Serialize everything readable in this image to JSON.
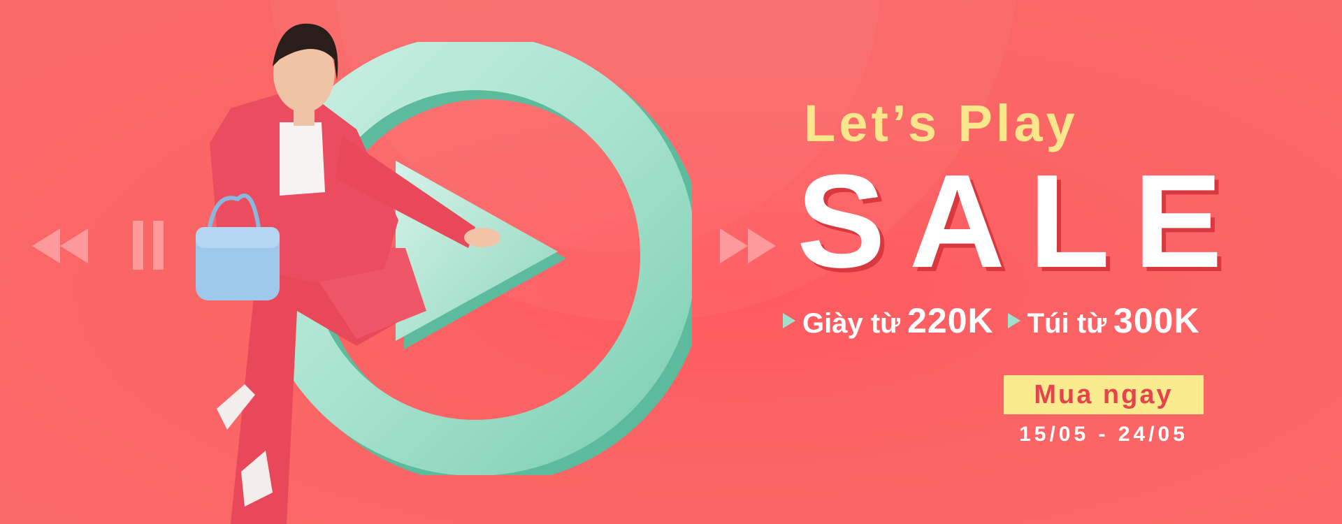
{
  "banner": {
    "headline": "Let’s Play",
    "title": "SALE",
    "offers": [
      {
        "label": "Giày từ",
        "price": "220K"
      },
      {
        "label": "Túi từ",
        "price": "300K"
      }
    ],
    "cta_label": "Mua ngay",
    "date_range": "15/05 - 24/05"
  },
  "icons": {
    "rewind": "rewind-icon",
    "pause": "pause-icon",
    "play": "play-icon",
    "fast_forward": "fast-forward-icon"
  },
  "colors": {
    "background": "#fa6262",
    "headline": "#fbe78b",
    "title": "#ffffff",
    "title_shadow": "#d9383e",
    "accent_mint": "#a8e3cf",
    "cta_bg": "#fbeb8f",
    "cta_text": "#e6444c"
  }
}
